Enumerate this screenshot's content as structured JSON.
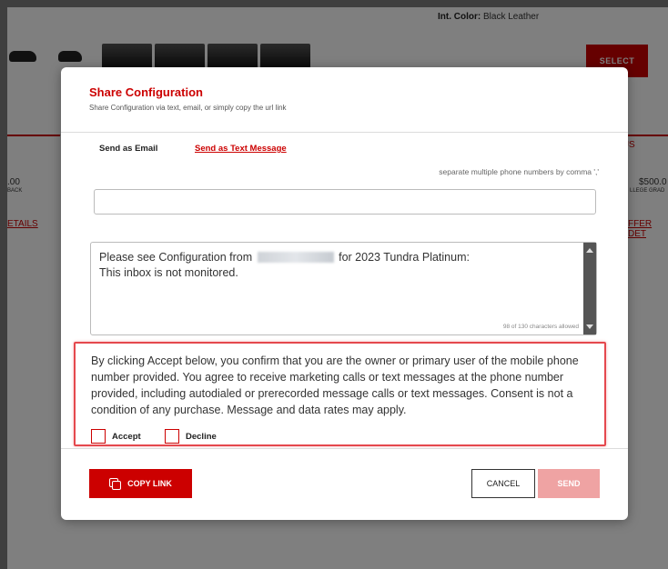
{
  "background": {
    "int_color_label": "Int. Color:",
    "int_color_value": "Black Leather",
    "select_button": "SELECT",
    "left_price": ".00",
    "left_price_sub": "BACK",
    "right_price": "$500.0",
    "right_price_sub": "LLEGE GRAD",
    "right_header": "JS",
    "left_link": "ETAILS",
    "right_link": "FFER DET"
  },
  "modal": {
    "title": "Share Configuration",
    "subtitle": "Share Configuration via text, email, or simply copy the url link",
    "tabs": [
      {
        "label": "Send as Email",
        "active": false
      },
      {
        "label": "Send as Text Message",
        "active": true
      }
    ],
    "phone_hint": "separate multiple phone numbers by comma ','",
    "phone_value": "",
    "message": {
      "line1_before": "Please see Configuration from",
      "line1_after": "for 2023 Tundra Platinum:",
      "line2": "This inbox is not monitored.",
      "counter": "98 of 130 characters allowed"
    },
    "consent": {
      "text": "By clicking Accept below, you confirm that you are the owner or primary user of the mobile phone number provided. You agree to receive marketing calls or text messages at the phone number provided, including autodialed or prerecorded message calls or text messages. Consent is not a condition of any purchase. Message and data rates may apply.",
      "accept_label": "Accept",
      "decline_label": "Decline"
    },
    "buttons": {
      "copy_link": "COPY LINK",
      "cancel": "CANCEL",
      "send": "SEND"
    }
  },
  "colors": {
    "accent": "#cc0000",
    "send_disabled": "#efa3a3",
    "consent_border": "#e5484d"
  }
}
